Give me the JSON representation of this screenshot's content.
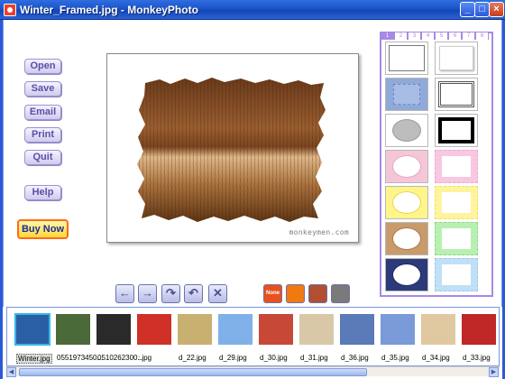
{
  "window": {
    "title": "Winter_Framed.jpg - MonkeyPhoto",
    "min_label": "_",
    "max_label": "□",
    "close_label": "×"
  },
  "sidebar": {
    "buttons": [
      "Open",
      "Save",
      "Email",
      "Print",
      "Quit"
    ],
    "help": "Help",
    "buy_now": "Buy Now"
  },
  "canvas": {
    "watermark": "monkeymen.com"
  },
  "frames": {
    "tabs": [
      "1",
      "2",
      "3",
      "4",
      "5",
      "6",
      "7",
      "8"
    ],
    "active_tab": "1",
    "styles": [
      {
        "name": "plain-white",
        "color": "#ffffff",
        "border": "#7a7a7a"
      },
      {
        "name": "white-shadow",
        "color": "#ffffff",
        "border": "#bcbcbc"
      },
      {
        "name": "blue-pattern",
        "color": "#8fa9d8",
        "border": "#6d88c4"
      },
      {
        "name": "double-line",
        "color": "#ffffff",
        "border": "#666666"
      },
      {
        "name": "grey-oval",
        "color": "#bdbdbd",
        "border": "#999999"
      },
      {
        "name": "black-heavy",
        "color": "#000000",
        "border": "#000000"
      },
      {
        "name": "pink-oval",
        "color": "#f5c5d8",
        "border": "#e8a6c0"
      },
      {
        "name": "pink-dotted",
        "color": "#f8c7e1",
        "border": "#f0a8d0"
      },
      {
        "name": "yellow-oval",
        "color": "#fff58a",
        "border": "#e6d84a"
      },
      {
        "name": "yellow-dotted",
        "color": "#fff49e",
        "border": "#f0e06a"
      },
      {
        "name": "tan-oval",
        "color": "#c99a6a",
        "border": "#a87a4a"
      },
      {
        "name": "green-dotted",
        "color": "#b7f0b0",
        "border": "#8fd888"
      },
      {
        "name": "navy-oval",
        "color": "#2c3a7a",
        "border": "#1e2a60"
      },
      {
        "name": "blue-dotted",
        "color": "#bfe0f6",
        "border": "#9ccae8"
      }
    ]
  },
  "toolbar": {
    "back_icon": "←",
    "forward_icon": "→",
    "rotate_right_icon": "↷",
    "rotate_left_icon": "↶",
    "delete_icon": "✕",
    "effects": [
      {
        "name": "none-effect",
        "label": "None",
        "color": "#e8501e"
      },
      {
        "name": "color-effect",
        "label": "",
        "color": "#f07a10"
      },
      {
        "name": "sepia-effect",
        "label": "",
        "color": "#b05030"
      },
      {
        "name": "grey-effect",
        "label": "",
        "color": "#7a7a7a"
      }
    ]
  },
  "filmstrip": {
    "items": [
      {
        "label": "Winter.jpg",
        "color": "#2b5fa5",
        "selected": true
      },
      {
        "label": "0551973450...",
        "color": "#4a6a3a",
        "selected": false
      },
      {
        "label": "0510262300...",
        "color": "#2a2a2a",
        "selected": false
      },
      {
        "label": ":.jpg",
        "color": "#d03028",
        "selected": false
      },
      {
        "label": "d_22.jpg",
        "color": "#c8b070",
        "selected": false
      },
      {
        "label": "d_29.jpg",
        "color": "#7fb0e8",
        "selected": false
      },
      {
        "label": "d_30.jpg",
        "color": "#c84838",
        "selected": false
      },
      {
        "label": "d_31.jpg",
        "color": "#d8c8a8",
        "selected": false
      },
      {
        "label": "d_36.jpg",
        "color": "#5a7ab8",
        "selected": false
      },
      {
        "label": "d_35.jpg",
        "color": "#7a9ad8",
        "selected": false
      },
      {
        "label": "d_34.jpg",
        "color": "#e0c8a0",
        "selected": false
      },
      {
        "label": "d_33.jpg",
        "color": "#c02828",
        "selected": false
      }
    ]
  }
}
